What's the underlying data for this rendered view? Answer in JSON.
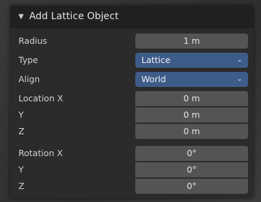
{
  "panel": {
    "title": "Add Lattice Object",
    "fields": {
      "radius": {
        "label": "Radius",
        "value": "1 m"
      },
      "type": {
        "label": "Type",
        "value": "Lattice"
      },
      "align": {
        "label": "Align",
        "value": "World"
      },
      "location_x": {
        "label": "Location X",
        "value": "0 m"
      },
      "location_y": {
        "label": "Y",
        "value": "0 m"
      },
      "location_z": {
        "label": "Z",
        "value": "0 m"
      },
      "rotation_x": {
        "label": "Rotation X",
        "value": "0°"
      },
      "rotation_y": {
        "label": "Y",
        "value": "0°"
      },
      "rotation_z": {
        "label": "Z",
        "value": "0°"
      }
    },
    "icons": {
      "collapse": "triangle-down-icon",
      "dropdown": "chevron-down-icon"
    },
    "colors": {
      "panel_bg": "#2b2b2b",
      "header_bg": "#202020",
      "field_bg": "#545454",
      "selected_field_bg": "#3e5c8a",
      "text": "#d2d2d2"
    }
  }
}
